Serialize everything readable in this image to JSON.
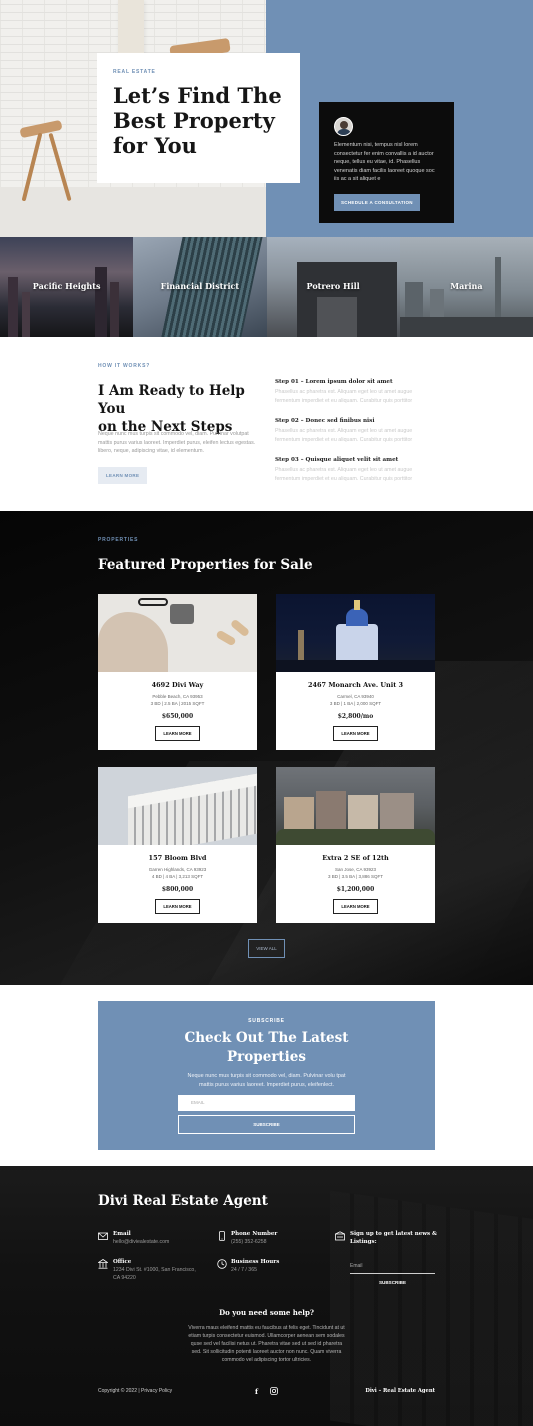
{
  "hero": {
    "eyebrow": "REAL ESTATE",
    "title_line1": "Let’s Find The",
    "title_line2": "Best Property",
    "title_line3": "for You",
    "card_text": "Elementum nisi, tempus nisl lorem consectetur fer enim convallis a id auctor neque, tellus eu vitae, id. Phasellus venenatis diam facilis laoreet quoque soc iis ac a sit aliquet e",
    "card_button": "SCHEDULE A CONSULTATION"
  },
  "neighborhoods": [
    "Pacific Heights",
    "Financial District",
    "Potrero Hill",
    "Marina"
  ],
  "how": {
    "eyebrow": "HOW IT WORKS?",
    "title_line1": "I Am Ready to Help You",
    "title_line2": "on the Next Steps",
    "text": "Neque nunc mus turpis sit commodo vel, diam. Pulvinar volutpat mattis purus varius laoreet. Imperdiet purus, eleifen lectus egestas. libero, neque, adipiscing vitae, id elementum.",
    "button": "LEARN MORE",
    "steps": [
      {
        "title": "Step 01 – Lorem ipsum dolor sit amet",
        "line1": "Phasellus ac pharetra est. Aliquam eget leo ut amet augue",
        "line2": "fermentum imperdiet et eu aliquam. Curabitur quis porttitor"
      },
      {
        "title": "Step 02 – Donec sed finibus nisi",
        "line1": "Phasellus ac pharetra est. Aliquam eget leo ut amet augue",
        "line2": "fermentum imperdiet et eu aliquam. Curabitur quis porttitor"
      },
      {
        "title": "Step 03 – Quisque aliquet velit sit amet",
        "line1": "Phasellus ac pharetra est. Aliquam eget leo ut amet augue",
        "line2": "fermentum imperdiet et eu aliquam. Curabitur quis porttitor"
      }
    ]
  },
  "featured": {
    "eyebrow": "PROPERTIES",
    "title": "Featured Properties for Sale",
    "button_label": "LEARN MORE",
    "view_all": "VIEW ALL",
    "properties": [
      {
        "name": "4692 Divi Way",
        "location": "Pebble Beach, CA 93953",
        "specs": "3 BD | 2.5 BA | 2015 SQFT",
        "price": "$650,000"
      },
      {
        "name": "2467 Monarch Ave. Unit 3",
        "location": "Carmel, CA 93940",
        "specs": "3 BD | 1 BA | 2,000 SQFT",
        "price": "$2,800/mo"
      },
      {
        "name": "157 Bloom Blvd",
        "location": "Garren Highlands, CA 93923",
        "specs": "4 BD | 4 BA | 3,213 SQFT",
        "price": "$800,000"
      },
      {
        "name": "Extra 2 SE of 12th",
        "location": "San Jose, CA 93923",
        "specs": "3 BD | 3.5 BA | 3,886 SQFT",
        "price": "$1,200,000"
      }
    ]
  },
  "subscribe": {
    "eyebrow": "SUBSCRIBE",
    "title_line1": "Check Out The Latest",
    "title_line2": "Properties",
    "text_line1": "Neque nunc mus turpis sit commodo vel, diam. Pulvinar volu tpat",
    "text_line2": "mattis purus varius laoreet. Imperdiet purus, eleifenlect.",
    "input_placeholder": "EMAIL",
    "button": "SUBSCRIBE"
  },
  "footer": {
    "title": "Divi Real Estate Agent",
    "email_label": "Email",
    "email_value": "hello@diviealestate.com",
    "phone_label": "Phone Number",
    "phone_value": "(255) 352-6258",
    "office_label": "Office",
    "office_line1": "1234 Divi St. #1000, San Francisco,",
    "office_line2": "CA 94220",
    "hours_label": "Business Hours",
    "hours_value": "24 / 7 / 365",
    "signup_label_line1": "Sign up to get latest news &",
    "signup_label_line2": "Listings:",
    "email_placeholder": "Email",
    "subscribe_button": "SUBSCRIBE",
    "help_title": "Do you need some help?",
    "help_lines": [
      "Viverra maus eleifend mattis eu faucibus at felis eget. Tincidunt at ut",
      "etiam turpis consectetur euismod. Ullamcorper aenean sem sodales",
      "quse sed vel facilisi netus ut. Pharetra vitae sed ut sed id pharetra",
      "sed. Sit sollicitudin potenti laoreet auctor non nunc. Quam viverra",
      "commodo vel adipiscing tortor ultricies."
    ],
    "copyright": "Copyright © 2022 | Privacy Policy",
    "brand_right": "Divi – Real Estate Agent"
  },
  "colors": {
    "accent": "#7090b5",
    "dark": "#0c0c0c"
  }
}
